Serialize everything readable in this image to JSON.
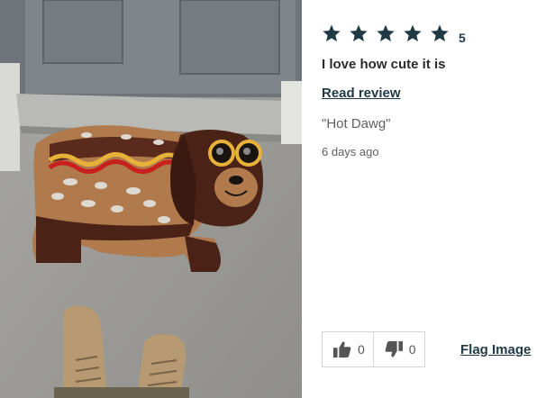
{
  "photo": {
    "alt_icon": "review-photo"
  },
  "review": {
    "stars": 5,
    "rating_value": "5",
    "headline": "I love how cute it is",
    "read_review_label": "Read review",
    "quote": "\"Hot Dawg\"",
    "age": "6 days ago"
  },
  "votes": {
    "helpful_count": "0",
    "unhelpful_count": "0",
    "helpful_icon": "thumbs-up-icon",
    "unhelpful_icon": "thumbs-down-icon"
  },
  "flag_label": "Flag Image",
  "colors": {
    "star": "#1f3a45",
    "link": "#1f3a45",
    "muted_text": "#5f5f5f"
  }
}
